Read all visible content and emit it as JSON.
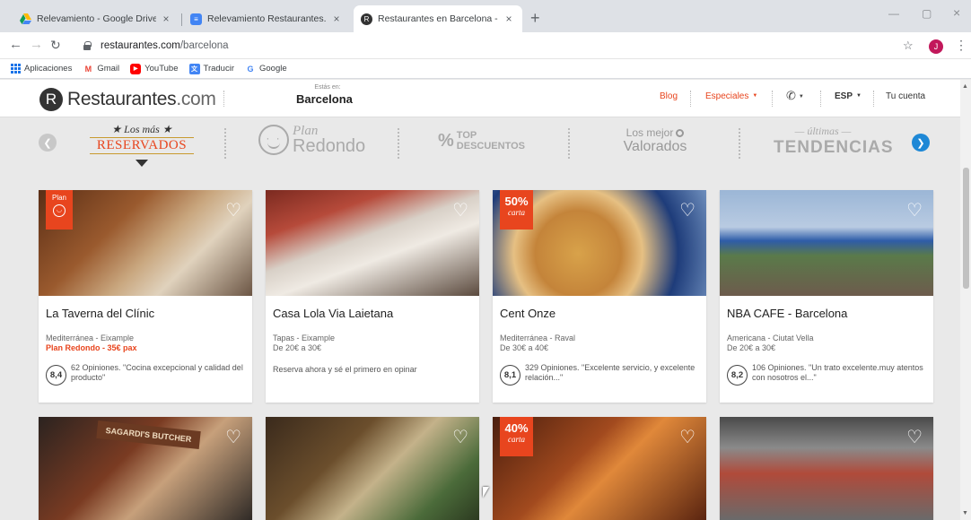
{
  "browser": {
    "tabs": [
      {
        "title": "Relevamiento - Google Drive",
        "close": "×",
        "icon": "google-drive-icon",
        "color": "#f4b400"
      },
      {
        "title": "Relevamiento Restaurantes.com",
        "close": "×",
        "icon": "google-docs-icon",
        "color": "#4285f4"
      },
      {
        "title": "Restaurantes en Barcelona - Rest",
        "close": "×",
        "icon": "restaurantes-icon",
        "color": "#333333"
      }
    ],
    "new_tab": "+",
    "url_domain": "restaurantes.com",
    "url_path": "/barcelona",
    "profile_initial": "J",
    "bookmarks": [
      {
        "label": "Aplicaciones",
        "icon": "apps-icon"
      },
      {
        "label": "Gmail",
        "icon": "gmail-icon",
        "glyph": "M",
        "color": "#ea4335"
      },
      {
        "label": "YouTube",
        "icon": "youtube-icon",
        "glyph": "▶",
        "color": "#ff0000"
      },
      {
        "label": "Traducir",
        "icon": "translate-icon",
        "glyph": "文",
        "color": "#4285f4"
      },
      {
        "label": "Google",
        "icon": "google-icon",
        "glyph": "G",
        "color": "#4285f4"
      }
    ]
  },
  "header": {
    "logo_letter": "R",
    "logo_word": "Restaurantes",
    "logo_suffix": ".com",
    "location_label": "Estás en:",
    "location_city": "Barcelona",
    "blog": "Blog",
    "especiales": "Especiales",
    "language": "ESP",
    "account": "Tu cuenta",
    "accent_color": "#e8451e"
  },
  "categories": {
    "mas_reservados_top": "★ Los más ★",
    "mas_reservados_bottom": "RESERVADOS",
    "plan": "Plan",
    "redondo": "Redondo",
    "top": "TOP",
    "descuentos": "DESCUENTOS",
    "mejor_l1": "Los mejor",
    "mejor_l2": "Valorados",
    "tend_l1": "— últimas —",
    "tend_l2": "TENDENCIAS"
  },
  "restaurants": [
    {
      "name": "La Taverna del Clínic",
      "cuisine": "Mediterránea - Eixample",
      "extra": "Plan Redondo - 35€ pax",
      "score": "8,4",
      "reviews": "62 Opiniones. \"Cocina excepcional y calidad del producto\"",
      "badge": "Plan"
    },
    {
      "name": "Casa Lola Via Laietana",
      "cuisine": "Tapas - Eixample",
      "extra": "De 20€ a 30€",
      "note": "Reserva ahora y sé el primero en opinar"
    },
    {
      "name": "Cent Onze",
      "cuisine": "Mediterránea - Raval",
      "extra": "De 30€ a 40€",
      "score": "8,1",
      "reviews": "329 Opiniones. \"Excelente servicio, y excelente relación...\"",
      "badge_pct": "50%",
      "badge_txt": "carta"
    },
    {
      "name": "NBA CAFE - Barcelona",
      "cuisine": "Americana - Ciutat Vella",
      "extra": "De 20€ a 30€",
      "score": "8,2",
      "reviews": "106 Opiniones. \"Un trato excelente.muy atentos con nosotros el...\""
    }
  ],
  "row2": [
    {
      "image": "butcher-shop"
    },
    {
      "image": "terrace"
    },
    {
      "image": "interior",
      "badge_pct": "40%",
      "badge_txt": "carta"
    },
    {
      "image": "dining-hall"
    }
  ]
}
